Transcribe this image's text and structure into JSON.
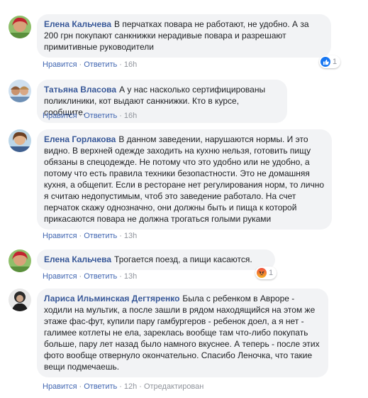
{
  "comments": [
    {
      "author": "Елена Кальчева",
      "text": "В перчатках повара не работают, не удобно. А за 200 грн покупают санкнижки нерадивые повара и разрешают примитивные руководители",
      "like_label": "Нравится",
      "reply_label": "Ответить",
      "time": "16h",
      "reaction": {
        "type": "like-icon",
        "count": "1"
      }
    },
    {
      "author": "Татьяна Власова",
      "text": "А у нас насколько сертифицированы поликлиники, кот выдают санкнижки. Кто в курсе, сообщите.",
      "like_label": "Нравится",
      "reply_label": "Ответить",
      "time": "16h"
    },
    {
      "author": "Елена Горлакова",
      "text": "В данном заведении, нарушаются нормы. И это видно. В верхней одежде заходить на кухню нельзя, готовить пищу обязаны в спецодежде. Не потому что это удобно или не удобно, а потому что есть правила техники безопастности. Это не домашняя кухня, а общепит. Если в ресторане нет регулирования норм, то лично я считаю недопустимым, чтоб это заведение работало. На счет перчаток скажу однозначно, они должны быть и пища к которой прикасаются повара не должна трогаться голыми руками",
      "like_label": "Нравится",
      "reply_label": "Ответить",
      "time": "13h"
    },
    {
      "author": "Елена Кальчева",
      "text": "Трогается поезд, а пищи касаются.",
      "like_label": "Нравится",
      "reply_label": "Ответить",
      "time": "13h",
      "reaction": {
        "type": "angry-icon",
        "count": "1"
      }
    },
    {
      "author": "Лариса Ильминская Дегтяренко",
      "text": "Была с ребенком в Авроре - ходили на мультик, а после зашли в рядом находящийся на этом же этаже фас-фут, купили пару гамбургеров - ребенок доел, а я нет - галимее котлеты не ела, зареклась вообще там что-либо покупать больше, пару лет назад было намного вкуснее. А теперь - после этих фото вообще отвернуло окончательно. Спасибо Леночка, что такие вещи подмечаешь.",
      "like_label": "Нравится",
      "reply_label": "Ответить",
      "time": "12h",
      "edited_label": "Отредактирован"
    }
  ],
  "colors": {
    "author": "#385898",
    "link": "#4267b2",
    "bubble": "#f2f3f5",
    "meta": "#90949c"
  }
}
